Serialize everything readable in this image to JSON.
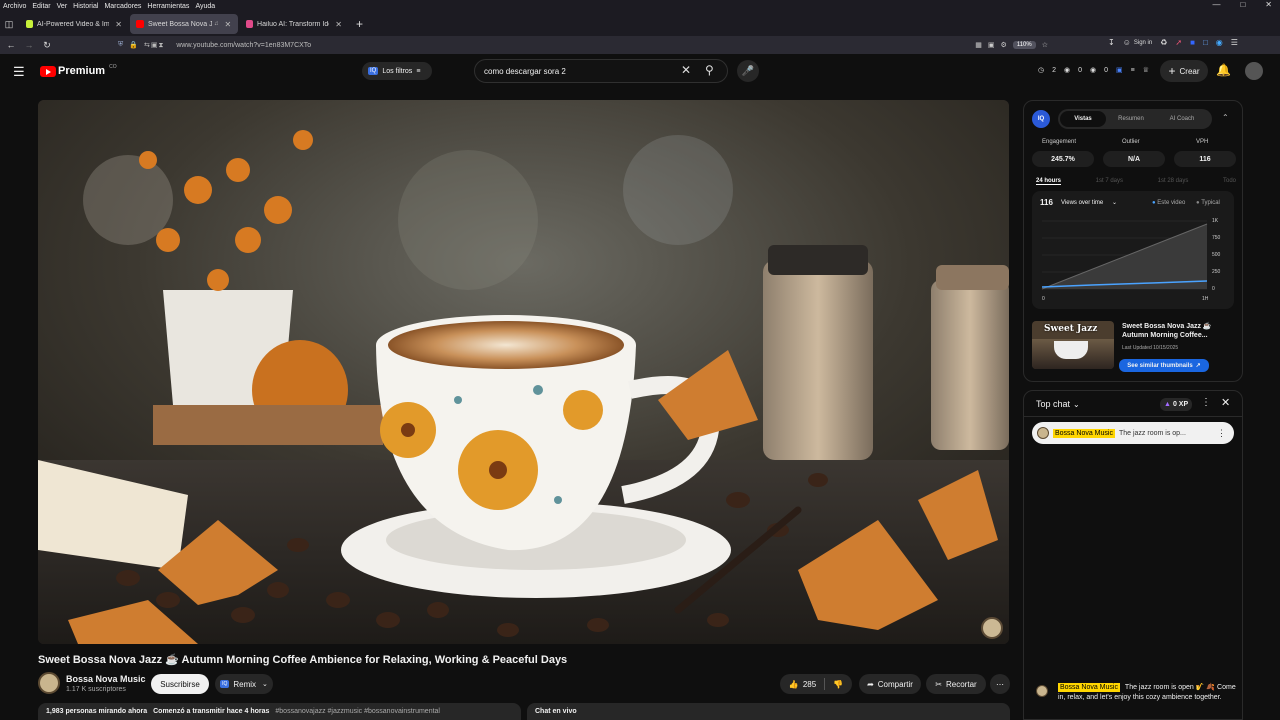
{
  "menubar": [
    "Archivo",
    "Editar",
    "Ver",
    "Historial",
    "Marcadores",
    "Herramientas",
    "Ayuda"
  ],
  "tabs": [
    {
      "title": "AI-Powered Video & Image Ge",
      "color": "#c7f03a",
      "active": false
    },
    {
      "title": "Sweet Bossa Nova Jazz",
      "color": "#ff0000",
      "active": true
    },
    {
      "title": "Hailuo AI: Transform Idea to Vic",
      "color": "#e04a8a",
      "active": false
    }
  ],
  "url": "www.youtube.com/watch?v=1en83M7CXTo",
  "zoom": "110%",
  "signin": "Sign in",
  "yt": {
    "logo": "Premium",
    "logo_sup": "CO",
    "filters": "Los filtros",
    "search_value": "como descargar sora 2",
    "counters": [
      "2",
      "0",
      "0"
    ],
    "create": "Crear"
  },
  "video": {
    "title": "Sweet Bossa Nova Jazz ☕ Autumn Morning Coffee Ambience for Relaxing, Working & Peaceful Days",
    "channel": "Bossa Nova Music",
    "subs": "1.17 K suscriptores",
    "subscribe": "Suscribirse",
    "remix": "Remix",
    "likes": "285",
    "share": "Compartir",
    "clip": "Recortar",
    "info_watching": "1,983 personas mirando ahora",
    "info_started": "Comenzó a transmitir hace 4 horas",
    "info_tags": "#bossanovajazz #jazzmusic #bossanovainstrumental",
    "live_chat_label": "Chat en vivo"
  },
  "vidiq": {
    "tabs": [
      "Vistas",
      "Resumen",
      "AI Coach"
    ],
    "metric_labels": [
      "Engagement",
      "Outlier",
      "VPH"
    ],
    "metric_values": [
      "245.7%",
      "N/A",
      "116"
    ],
    "ranges": [
      "24 hours",
      "1st 7 days",
      "1st 28 days",
      "Todo"
    ],
    "views_count": "116",
    "views_label": "Views over time",
    "legend_this": "Este video",
    "legend_typical": "Typical",
    "y_ticks": [
      "1K",
      "750",
      "500",
      "250",
      "0"
    ],
    "x_ticks": [
      "0",
      "1H"
    ],
    "thumb_text": "Sweet Jazz",
    "thumb_title": "Sweet Bossa Nova Jazz ☕ Autumn Morning Coffee...",
    "updated": "Last Updated 10/15/2025",
    "similar": "See similar thumbnails"
  },
  "chat": {
    "header": "Top chat",
    "xp": "0 XP",
    "pinned_author": "Bossa Nova Music",
    "pinned_text": "The jazz room is op...",
    "msg_author": "Bossa Nova Music",
    "msg_text": "The jazz room is open 🎷 🍂 Come in, relax, and let's enjoy this cozy ambience together."
  }
}
